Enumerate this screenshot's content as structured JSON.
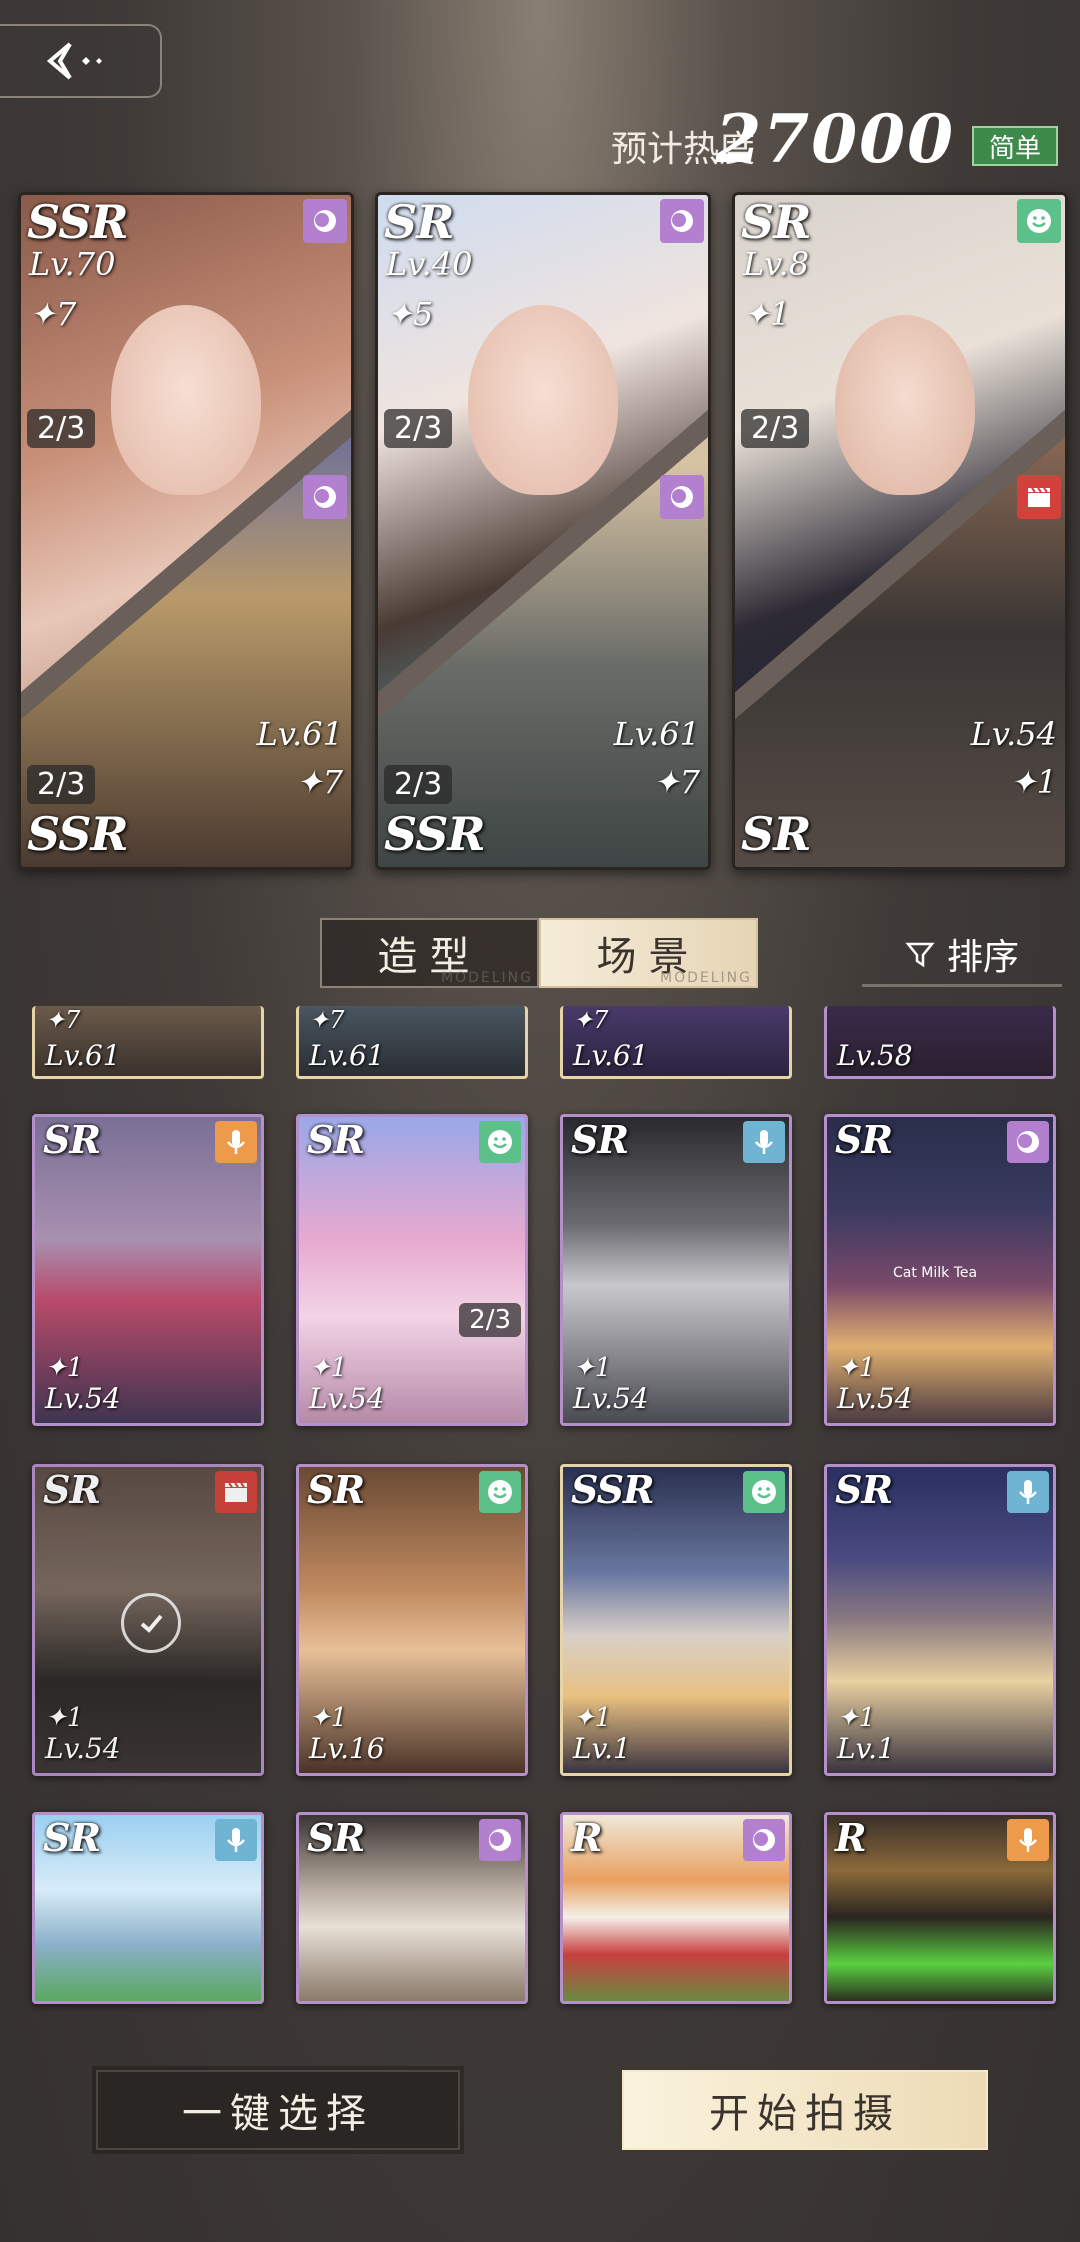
{
  "header": {
    "heat_label": "预计热度",
    "heat_value": "27000",
    "difficulty": "简单"
  },
  "selected_cards": [
    {
      "rarity_top": "SSR",
      "level_top": "Lv.70",
      "stars_top": "✦7",
      "count_top": "2/3",
      "rarity_bottom": "SSR",
      "level_bottom": "Lv.61",
      "stars_bottom": "✦7",
      "count_bottom": "2/3",
      "badge_top": "circle-icon",
      "badge_bottom": "circle-icon"
    },
    {
      "rarity_top": "SR",
      "level_top": "Lv.40",
      "stars_top": "✦5",
      "count_top": "2/3",
      "rarity_bottom": "SSR",
      "level_bottom": "Lv.61",
      "stars_bottom": "✦7",
      "count_bottom": "2/3",
      "badge_top": "circle-icon",
      "badge_bottom": "circle-icon"
    },
    {
      "rarity_top": "SR",
      "level_top": "Lv.8",
      "stars_top": "✦1",
      "count_top": "2/3",
      "rarity_bottom": "SR",
      "level_bottom": "Lv.54",
      "stars_bottom": "✦1",
      "count_bottom": "",
      "badge_top": "smile-icon",
      "badge_bottom": "clapper-icon"
    }
  ],
  "tabs": {
    "styling": "造型",
    "scene": "场景",
    "scene_sub": "MODELING",
    "styling_sub": "MODELING"
  },
  "sort_label": "排序",
  "partial_row": [
    {
      "stars": "✦7",
      "level": "Lv.61"
    },
    {
      "stars": "✦7",
      "level": "Lv.61"
    },
    {
      "stars": "✦7",
      "level": "Lv.61"
    },
    {
      "stars": "",
      "level": "Lv.58"
    }
  ],
  "scene_cards": [
    {
      "rarity": "SR",
      "stars": "✦1",
      "level": "Lv.54",
      "badge": "mic-icon",
      "count": ""
    },
    {
      "rarity": "SR",
      "stars": "✦1",
      "level": "Lv.54",
      "badge": "smile-icon",
      "count": "2/3"
    },
    {
      "rarity": "SR",
      "stars": "✦1",
      "level": "Lv.54",
      "badge": "mic-icon",
      "count": ""
    },
    {
      "rarity": "SR",
      "stars": "✦1",
      "level": "Lv.54",
      "badge": "circle-icon",
      "count": "",
      "shop_sign": "Cat Milk Tea"
    },
    {
      "rarity": "SR",
      "stars": "✦1",
      "level": "Lv.54",
      "badge": "clapper-icon",
      "count": "",
      "selected": true
    },
    {
      "rarity": "SR",
      "stars": "✦1",
      "level": "Lv.16",
      "badge": "smile-icon",
      "count": ""
    },
    {
      "rarity": "SSR",
      "stars": "✦1",
      "level": "Lv.1",
      "badge": "smile-icon",
      "count": ""
    },
    {
      "rarity": "SR",
      "stars": "✦1",
      "level": "Lv.1",
      "badge": "mic-icon",
      "count": ""
    },
    {
      "rarity": "SR",
      "stars": "",
      "level": "",
      "badge": "mic-icon",
      "count": ""
    },
    {
      "rarity": "SR",
      "stars": "",
      "level": "",
      "badge": "circle-icon",
      "count": ""
    },
    {
      "rarity": "R",
      "stars": "",
      "level": "",
      "badge": "circle-icon",
      "count": ""
    },
    {
      "rarity": "R",
      "stars": "",
      "level": "",
      "badge": "mic-icon",
      "count": ""
    }
  ],
  "buttons": {
    "quick_select": "一键选择",
    "start_shoot": "开始拍摄"
  },
  "colors": {
    "difficulty_bg": "#3e8a4a",
    "card_border_sr": "#b48fca",
    "card_border_ssr": "#e6d3a6",
    "start_button": "#f3e6c6"
  }
}
